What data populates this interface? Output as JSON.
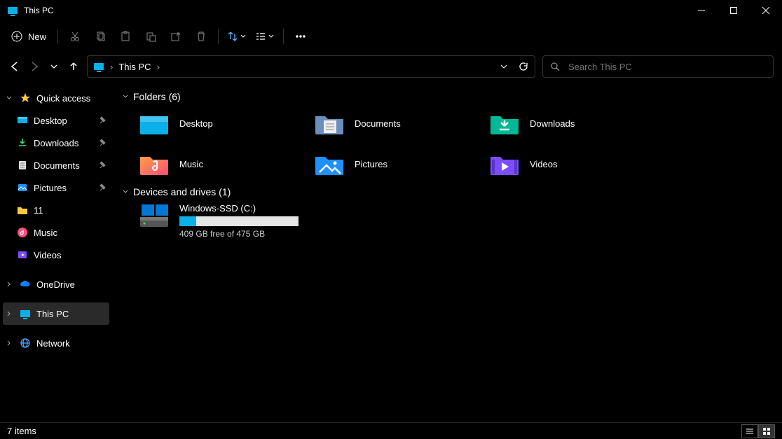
{
  "titlebar": {
    "title": "This PC"
  },
  "toolbar": {
    "new_label": "New"
  },
  "address": {
    "location": "This PC"
  },
  "search": {
    "placeholder": "Search This PC"
  },
  "sidebar": {
    "quick_access": "Quick access",
    "items": [
      {
        "label": "Desktop",
        "pinned": true
      },
      {
        "label": "Downloads",
        "pinned": true
      },
      {
        "label": "Documents",
        "pinned": true
      },
      {
        "label": "Pictures",
        "pinned": true
      },
      {
        "label": "11",
        "pinned": false
      },
      {
        "label": "Music",
        "pinned": false
      },
      {
        "label": "Videos",
        "pinned": false
      }
    ],
    "onedrive": "OneDrive",
    "this_pc": "This PC",
    "network": "Network"
  },
  "content": {
    "folders_header": "Folders (6)",
    "folders": [
      {
        "label": "Desktop"
      },
      {
        "label": "Documents"
      },
      {
        "label": "Downloads"
      },
      {
        "label": "Music"
      },
      {
        "label": "Pictures"
      },
      {
        "label": "Videos"
      }
    ],
    "drives_header": "Devices and drives (1)",
    "drive": {
      "label": "Windows-SSD (C:)",
      "free_text": "409 GB free of 475 GB",
      "used_percent": 14
    }
  },
  "statusbar": {
    "text": "7 items"
  }
}
